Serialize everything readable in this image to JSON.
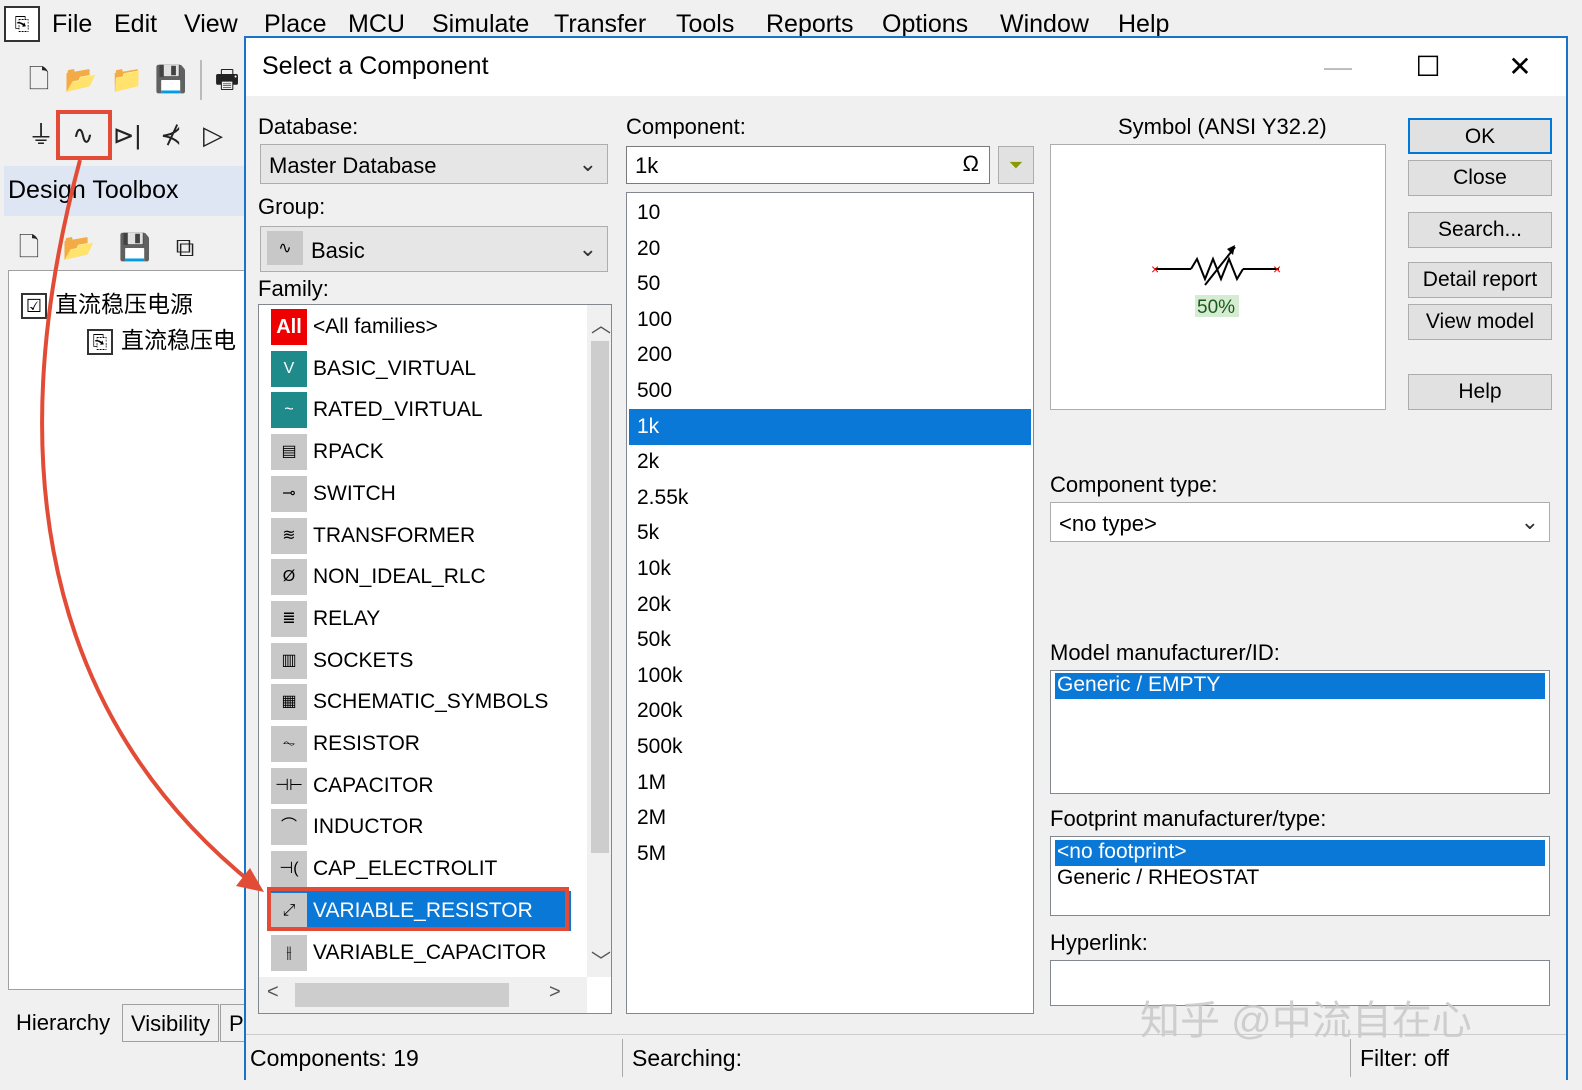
{
  "app": {
    "menu": [
      "File",
      "Edit",
      "View",
      "Place",
      "MCU",
      "Simulate",
      "Transfer",
      "Tools",
      "Reports",
      "Options",
      "Window",
      "Help"
    ]
  },
  "toolbox": {
    "title": "Design Toolbox",
    "tree": {
      "root": "直流稳压电源",
      "child": "直流稳压电"
    },
    "tabs": [
      "Hierarchy",
      "Visibility",
      "P"
    ]
  },
  "dialog": {
    "title": "Select a Component",
    "database_label": "Database:",
    "database_value": "Master Database",
    "group_label": "Group:",
    "group_value": "Basic",
    "family_label": "Family:",
    "families": [
      {
        "icon": "All",
        "label": "<All families>"
      },
      {
        "icon": "V",
        "label": "BASIC_VIRTUAL"
      },
      {
        "icon": "~",
        "label": "RATED_VIRTUAL"
      },
      {
        "icon": "▤",
        "label": "RPACK"
      },
      {
        "icon": "⊸",
        "label": "SWITCH"
      },
      {
        "icon": "≋",
        "label": "TRANSFORMER"
      },
      {
        "icon": "Ø",
        "label": "NON_IDEAL_RLC"
      },
      {
        "icon": "≣",
        "label": "RELAY"
      },
      {
        "icon": "▥",
        "label": "SOCKETS"
      },
      {
        "icon": "▦",
        "label": "SCHEMATIC_SYMBOLS"
      },
      {
        "icon": "⏦",
        "label": "RESISTOR"
      },
      {
        "icon": "⊣⊢",
        "label": "CAPACITOR"
      },
      {
        "icon": "⌒",
        "label": "INDUCTOR"
      },
      {
        "icon": "⊣(",
        "label": "CAP_ELECTROLIT"
      },
      {
        "icon": "⤢",
        "label": "VARIABLE_RESISTOR"
      },
      {
        "icon": "⫲",
        "label": "VARIABLE_CAPACITOR"
      }
    ],
    "selected_family": "VARIABLE_RESISTOR",
    "component_label": "Component:",
    "component_value": "1k",
    "components": [
      "10",
      "20",
      "50",
      "100",
      "200",
      "500",
      "1k",
      "2k",
      "2.55k",
      "5k",
      "10k",
      "20k",
      "50k",
      "100k",
      "200k",
      "500k",
      "1M",
      "2M",
      "5M"
    ],
    "selected_component": "1k",
    "symbol_label": "Symbol (ANSI Y32.2)",
    "symbol_value": "50%",
    "buttons": {
      "ok": "OK",
      "close": "Close",
      "search": "Search...",
      "detail_report": "Detail report",
      "view_model": "View model",
      "help": "Help"
    },
    "component_type_label": "Component type:",
    "component_type_value": "<no type>",
    "model_label": "Model manufacturer/ID:",
    "model_items": [
      "Generic / EMPTY"
    ],
    "footprint_label": "Footprint manufacturer/type:",
    "footprint_items": [
      "<no footprint>",
      "Generic / RHEOSTAT"
    ],
    "hyperlink_label": "Hyperlink:",
    "status": {
      "components": "Components: 19",
      "searching": "Searching:",
      "filter": "Filter: off"
    }
  },
  "watermark": "知乎 @中流自在心",
  "colors": {
    "selection": "#0a78d7",
    "annotation": "#e24c36"
  }
}
